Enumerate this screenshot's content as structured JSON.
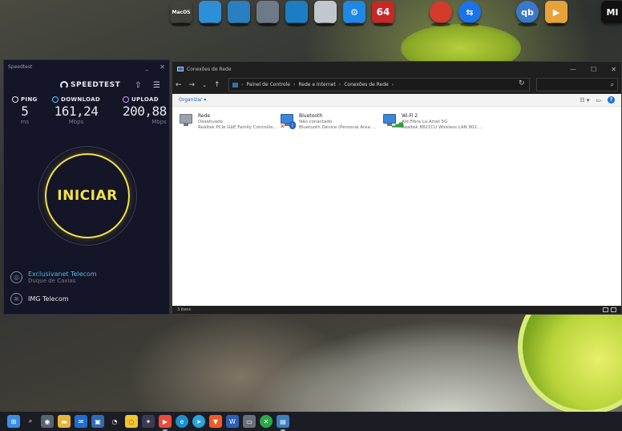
{
  "dock": {
    "items": [
      {
        "name": "macos-app",
        "label": "MacOS",
        "color": "#3a3a3a"
      },
      {
        "name": "desktop-app",
        "label": "",
        "color": "#2d8fd6"
      },
      {
        "name": "control-panel",
        "label": "",
        "color": "#2a7fc1"
      },
      {
        "name": "recycle-bin",
        "label": "",
        "color": "#6f7a88"
      },
      {
        "name": "dock-app-5",
        "label": "",
        "color": "#1b7ec4"
      },
      {
        "name": "dock-app-6",
        "label": "",
        "color": "#c2c7cf"
      },
      {
        "name": "dock-app-7",
        "label": "",
        "color": "#555"
      },
      {
        "name": "settings",
        "label": "",
        "color": "#1e88e5"
      },
      {
        "name": "aida64",
        "label": "64",
        "color": "#c62828"
      },
      {
        "name": "ccleaner",
        "label": "",
        "color": "#d33b2c"
      },
      {
        "name": "teamviewer",
        "label": "",
        "color": "#1a73e8"
      },
      {
        "name": "qbittorrent",
        "label": "qb",
        "color": "#3a78c9"
      },
      {
        "name": "media-player",
        "label": "",
        "color": "#e8a23a"
      },
      {
        "name": "xiaomi",
        "label": "mi",
        "color": "#111"
      }
    ]
  },
  "speedtest": {
    "window_title": "Speedtest",
    "brand": "SPEEDTEST",
    "ping": {
      "label": "PING",
      "value": "5",
      "unit": "ms"
    },
    "download": {
      "label": "DOWNLOAD",
      "value": "161,24",
      "unit": "Mbps"
    },
    "upload": {
      "label": "UPLOAD",
      "value": "200,88",
      "unit": "Mbps"
    },
    "start_label": "INICIAR",
    "isp": {
      "name": "Exclusivanet Telecom",
      "location": "Duque de Caxias"
    },
    "server": {
      "name": "IMG Telecom"
    },
    "colors": {
      "ping": "#e8e8f0",
      "download": "#56c8f2",
      "upload": "#c79ff0",
      "accent": "#f4e24a"
    }
  },
  "explorer": {
    "window_title": "Conexões de Rede",
    "breadcrumbs": [
      "Painel de Controle",
      "Rede e Internet",
      "Conexões de Rede"
    ],
    "organize_label": "Organizar",
    "adapters": [
      {
        "name": "Rede",
        "status": "Desativado",
        "device": "Realtek PCIe GbE Family Controlle..."
      },
      {
        "name": "Bluetooth",
        "status": "Não conectado",
        "device": "Bluetooth Device (Personal Area ..."
      },
      {
        "name": "Wi-Fi 2",
        "status": "Ald.Fibra La.Amel 5G",
        "device": "Realtek 8821CU Wireless LAN 802...."
      }
    ],
    "status_text": "3 itens"
  },
  "taskbar": {
    "items": [
      {
        "name": "start",
        "color": "#3a8ee6"
      },
      {
        "name": "search",
        "color": "#1c1d24"
      },
      {
        "name": "camera",
        "color": "#5b6270"
      },
      {
        "name": "file-explorer",
        "color": "#e7b43a"
      },
      {
        "name": "mail",
        "color": "#1e6fcf"
      },
      {
        "name": "photos",
        "color": "#2f6bb3"
      },
      {
        "name": "speedtest",
        "color": "#1c1d24"
      },
      {
        "name": "chat",
        "color": "#f4c430"
      },
      {
        "name": "widgets",
        "color": "#3a3a55"
      },
      {
        "name": "media",
        "color": "#e74c3c"
      },
      {
        "name": "edge",
        "color": "#1f8fd0"
      },
      {
        "name": "telegram",
        "color": "#2aa3de"
      },
      {
        "name": "brave",
        "color": "#f05a28"
      },
      {
        "name": "word",
        "color": "#2b5fb4"
      },
      {
        "name": "window-app",
        "color": "#6a6f7a"
      },
      {
        "name": "xbox",
        "color": "#2aa84a"
      },
      {
        "name": "network",
        "color": "#3a7fbf"
      }
    ]
  }
}
